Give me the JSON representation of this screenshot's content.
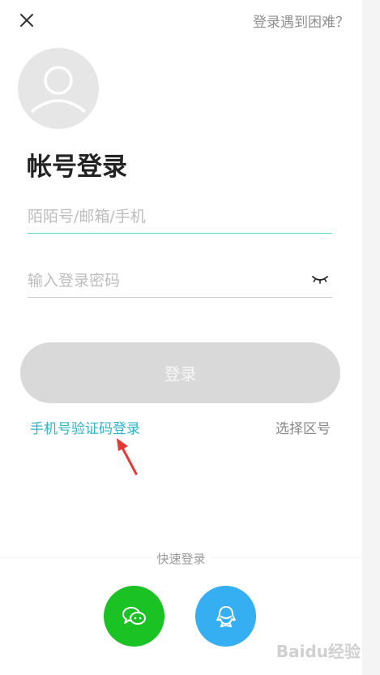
{
  "header": {
    "close_icon": "close-icon",
    "help_link": "登录遇到困难？"
  },
  "avatar": {
    "icon": "user-avatar-icon"
  },
  "page_title": "帐号登录",
  "form": {
    "username_placeholder": "陌陌号/邮箱/手机",
    "password_placeholder": "输入登录密码",
    "password_toggle_icon": "eye-closed-icon",
    "login_button": "登录",
    "sms_login_link": "手机号验证码登录",
    "select_region_link": "选择区号"
  },
  "quick_login": {
    "label": "快速登录",
    "wechat_icon": "wechat-icon",
    "qq_icon": "qq-icon"
  },
  "watermark": "Baidu经验",
  "colors": {
    "accent_teal": "#53d9be",
    "link_teal": "#2fb5c9",
    "button_disabled": "#d9d9d9",
    "wechat_green": "#1bc224",
    "qq_blue": "#35aef2",
    "annotation_red": "#e53935"
  }
}
